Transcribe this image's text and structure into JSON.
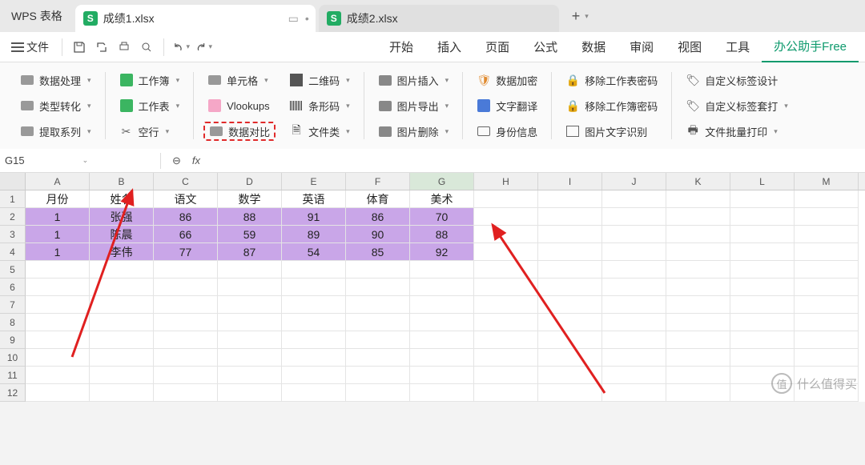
{
  "tabs": {
    "app_label": "WPS 表格",
    "file1": "成绩1.xlsx",
    "file2": "成绩2.xlsx"
  },
  "menubar": {
    "file": "文件",
    "tabs": [
      "开始",
      "插入",
      "页面",
      "公式",
      "数据",
      "审阅",
      "视图",
      "工具",
      "办公助手Free"
    ]
  },
  "ribbon": {
    "c1": {
      "a": "数据处理",
      "b": "类型转化",
      "c": "提取系列"
    },
    "c2": {
      "a": "工作簿",
      "b": "工作表",
      "c": "空行"
    },
    "c3": {
      "a": "单元格",
      "b": "Vlookups",
      "c": "数据对比"
    },
    "c4": {
      "a": "二维码",
      "b": "条形码",
      "c": "文件类"
    },
    "c5": {
      "a": "图片插入",
      "b": "图片导出",
      "c": "图片删除"
    },
    "c6": {
      "a": "数据加密",
      "b": "文字翻译",
      "c": "身份信息"
    },
    "c7": {
      "a": "移除工作表密码",
      "b": "移除工作簿密码",
      "c": "图片文字识别"
    },
    "c8": {
      "a": "自定义标签设计",
      "b": "自定义标签套打",
      "c": "文件批量打印"
    }
  },
  "namebox": {
    "cell": "G15",
    "fx": "fx"
  },
  "columns": [
    "A",
    "B",
    "C",
    "D",
    "E",
    "F",
    "G",
    "H",
    "I",
    "J",
    "K",
    "L",
    "M"
  ],
  "rows_shown": 12,
  "sheet": {
    "header": [
      "月份",
      "姓名",
      "语文",
      "数学",
      "英语",
      "体育",
      "美术"
    ],
    "data": [
      [
        "1",
        "张强",
        "86",
        "88",
        "91",
        "86",
        "70"
      ],
      [
        "1",
        "陈晨",
        "66",
        "59",
        "89",
        "90",
        "88"
      ],
      [
        "1",
        "李伟",
        "77",
        "87",
        "54",
        "85",
        "92"
      ]
    ]
  },
  "watermark": {
    "icon": "值",
    "text": "什么值得买"
  }
}
